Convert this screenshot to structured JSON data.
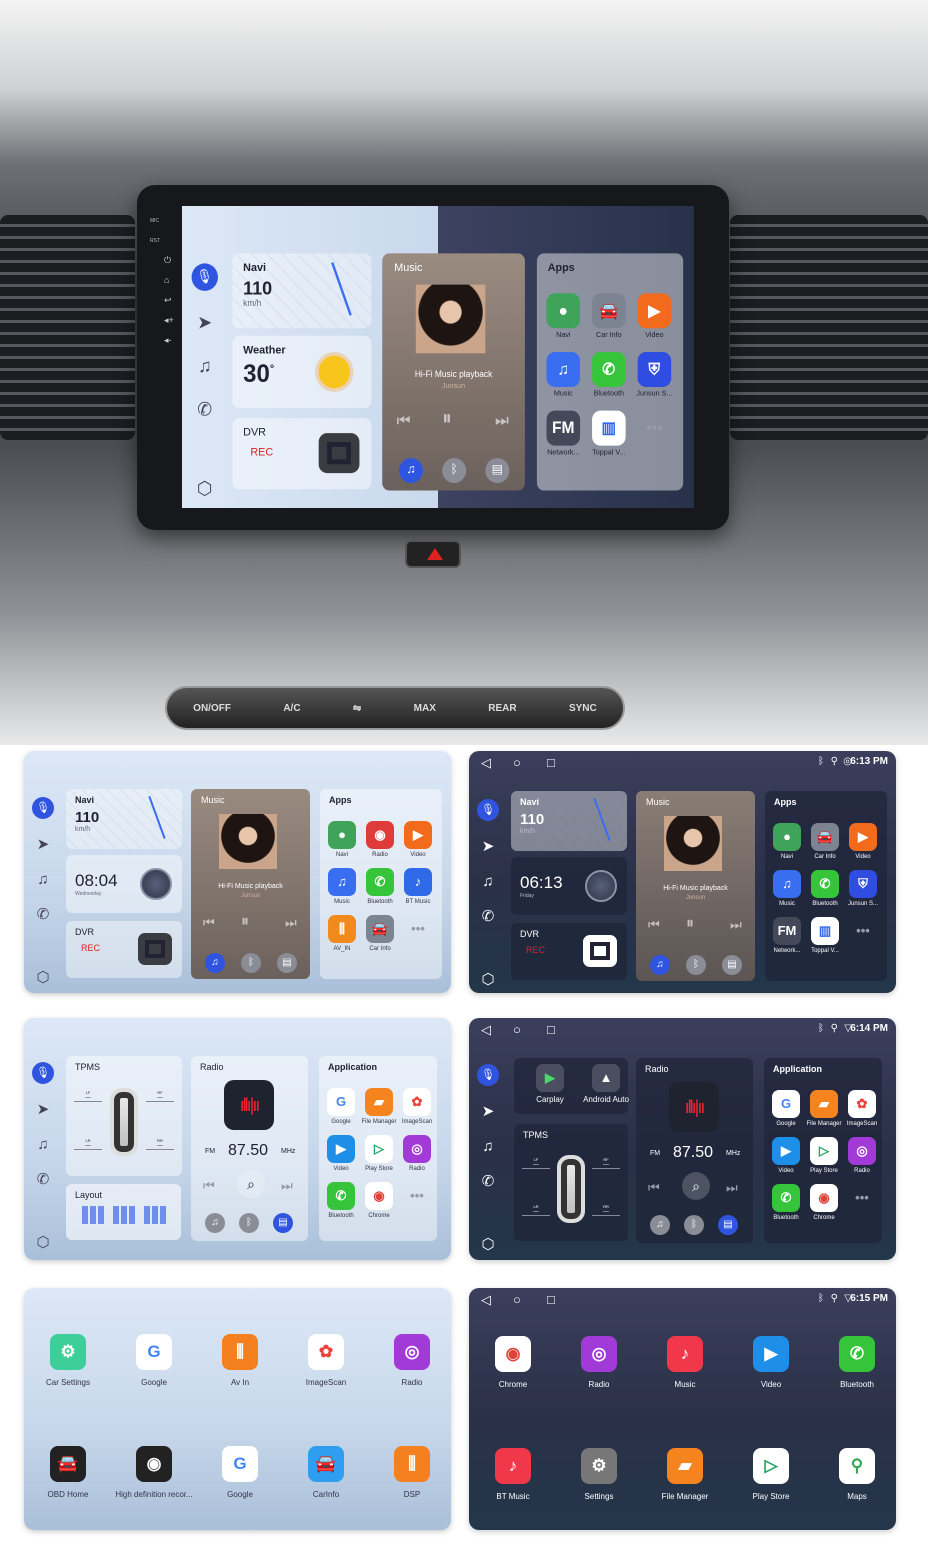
{
  "hero": {
    "side_buttons": [
      "MIC",
      "RST"
    ],
    "climate_buttons": [
      "ON/OFF",
      "A/C",
      "MAX",
      "REAR",
      "SYNC"
    ]
  },
  "screens": [
    {
      "type": "home",
      "theme": "split",
      "status": null,
      "navi": {
        "title": "Navi",
        "speed": "110",
        "unit": "km/h"
      },
      "widget": {
        "kind": "weather",
        "title": "Weather",
        "value": "30",
        "unit": "°"
      },
      "dvr": {
        "title": "DVR",
        "status": "REC"
      },
      "music": {
        "title": "Music",
        "track": "Hi-Fi Music playback",
        "artist": "Junsun"
      },
      "apps": {
        "title": "Apps",
        "items": [
          {
            "label": "Navi",
            "icon": "map-pin",
            "color": "#3fa35a"
          },
          {
            "label": "Car Info",
            "icon": "car",
            "color": "#7d8491"
          },
          {
            "label": "Video",
            "icon": "play",
            "color": "#f26b1d"
          },
          {
            "label": "Music",
            "icon": "music",
            "color": "#3a6ef0"
          },
          {
            "label": "Bluetooth",
            "icon": "phone",
            "color": "#35c43a"
          },
          {
            "label": "Junsun S...",
            "icon": "shield",
            "color": "#2f4de0"
          },
          {
            "label": "Network...",
            "icon": "fm",
            "color": "#44495a"
          },
          {
            "label": "Toppal V...",
            "icon": "wave",
            "color": "#ffffff"
          },
          {
            "label": "",
            "icon": "more",
            "color": "transparent"
          }
        ]
      }
    },
    {
      "type": "home",
      "theme": "light",
      "status": null,
      "navi": {
        "title": "Navi",
        "speed": "110",
        "unit": "km/h"
      },
      "widget": {
        "kind": "clock",
        "value": "08:04",
        "sub": "Wednesday"
      },
      "dvr": {
        "title": "DVR",
        "status": "REC"
      },
      "music": {
        "title": "Music",
        "track": "Hi-Fi Music playback",
        "artist": "Junsun"
      },
      "apps": {
        "title": "Apps",
        "items": [
          {
            "label": "Navi",
            "icon": "map-pin",
            "color": "#3fa35a"
          },
          {
            "label": "Radio",
            "icon": "radio",
            "color": "#e03b3b"
          },
          {
            "label": "Video",
            "icon": "play",
            "color": "#f26b1d"
          },
          {
            "label": "Music",
            "icon": "music",
            "color": "#3a6ef0"
          },
          {
            "label": "Bluetooth",
            "icon": "phone",
            "color": "#35c43a"
          },
          {
            "label": "BT Music",
            "icon": "bt-music",
            "color": "#2f6be8"
          },
          {
            "label": "AV_IN",
            "icon": "sliders",
            "color": "#f08a1d"
          },
          {
            "label": "Car Info",
            "icon": "car",
            "color": "#7d8491"
          },
          {
            "label": "",
            "icon": "more",
            "color": "transparent"
          }
        ]
      }
    },
    {
      "type": "home",
      "theme": "dark",
      "status": {
        "time": "6:13 PM",
        "wifi": "hotspot"
      },
      "navi": {
        "title": "Navi",
        "speed": "110",
        "unit": "km/h"
      },
      "widget": {
        "kind": "clock",
        "value": "06:13",
        "sub": "Friday"
      },
      "dvr": {
        "title": "DVR",
        "status": "REC"
      },
      "music": {
        "title": "Music",
        "track": "Hi-Fi Music playback",
        "artist": "Junsun"
      },
      "apps": {
        "title": "Apps",
        "items": [
          {
            "label": "Navi",
            "icon": "map-pin",
            "color": "#3fa35a"
          },
          {
            "label": "Car Info",
            "icon": "car",
            "color": "#7d8491"
          },
          {
            "label": "Video",
            "icon": "play",
            "color": "#f26b1d"
          },
          {
            "label": "Music",
            "icon": "music",
            "color": "#3a6ef0"
          },
          {
            "label": "Bluetooth",
            "icon": "phone",
            "color": "#35c43a"
          },
          {
            "label": "Junsun S...",
            "icon": "shield",
            "color": "#2f4de0"
          },
          {
            "label": "Network...",
            "icon": "fm",
            "color": "#44495a"
          },
          {
            "label": "Toppal V...",
            "icon": "wave",
            "color": "#ffffff"
          },
          {
            "label": "",
            "icon": "more",
            "color": "transparent"
          }
        ]
      }
    },
    {
      "type": "radio",
      "theme": "light",
      "status": null,
      "tpms": {
        "title": "TPMS",
        "tires": [
          {
            "pos": "LF",
            "value": "---"
          },
          {
            "pos": "RF",
            "value": "---"
          },
          {
            "pos": "LR",
            "value": "---"
          },
          {
            "pos": "RR",
            "value": "---"
          }
        ]
      },
      "layout": {
        "title": "Layout"
      },
      "radio": {
        "title": "Radio",
        "band": "FM",
        "freq": "87.50",
        "unit": "MHz"
      },
      "apps": {
        "title": "Application",
        "items": [
          {
            "label": "Google",
            "icon": "google",
            "color": "#ffffff"
          },
          {
            "label": "File Manager",
            "icon": "folder",
            "color": "#f5841f"
          },
          {
            "label": "ImageScan",
            "icon": "photos",
            "color": "#ffffff"
          },
          {
            "label": "Video",
            "icon": "video",
            "color": "#1e8fe8"
          },
          {
            "label": "Play Store",
            "icon": "play-store",
            "color": "#ffffff"
          },
          {
            "label": "Radio",
            "icon": "podcast",
            "color": "#a23ad8"
          },
          {
            "label": "Bluetooth",
            "icon": "phone",
            "color": "#35c43a"
          },
          {
            "label": "Chrome",
            "icon": "chrome",
            "color": "#ffffff"
          },
          {
            "label": "",
            "icon": "more",
            "color": "transparent"
          }
        ]
      }
    },
    {
      "type": "radio",
      "theme": "dark",
      "status": {
        "time": "6:14 PM",
        "wifi": "wifi"
      },
      "projection": [
        {
          "label": "Carplay",
          "icon": "carplay"
        },
        {
          "label": "Android Auto",
          "icon": "android-auto"
        }
      ],
      "tpms": {
        "title": "TPMS",
        "tires": [
          {
            "pos": "LF",
            "value": "---"
          },
          {
            "pos": "RF",
            "value": "---"
          },
          {
            "pos": "LR",
            "value": "---"
          },
          {
            "pos": "RR",
            "value": "---"
          }
        ]
      },
      "radio": {
        "title": "Radio",
        "band": "FM",
        "freq": "87.50",
        "unit": "MHz"
      },
      "apps": {
        "title": "Application",
        "items": [
          {
            "label": "Google",
            "icon": "google",
            "color": "#ffffff"
          },
          {
            "label": "File Manager",
            "icon": "folder",
            "color": "#f5841f"
          },
          {
            "label": "ImageScan",
            "icon": "photos",
            "color": "#ffffff"
          },
          {
            "label": "Video",
            "icon": "video",
            "color": "#1e8fe8"
          },
          {
            "label": "Play Store",
            "icon": "play-store",
            "color": "#ffffff"
          },
          {
            "label": "Radio",
            "icon": "podcast",
            "color": "#a23ad8"
          },
          {
            "label": "Bluetooth",
            "icon": "phone",
            "color": "#35c43a"
          },
          {
            "label": "Chrome",
            "icon": "chrome",
            "color": "#ffffff"
          },
          {
            "label": "",
            "icon": "more",
            "color": "transparent"
          }
        ]
      }
    },
    {
      "type": "grid",
      "theme": "light",
      "status": null,
      "apps": {
        "items": [
          {
            "label": "Car Settings",
            "icon": "car-settings",
            "color": "#3ccf9a"
          },
          {
            "label": "Google",
            "icon": "google",
            "color": "#ffffff"
          },
          {
            "label": "Av In",
            "icon": "sliders",
            "color": "#f5801f"
          },
          {
            "label": "ImageScan",
            "icon": "photos",
            "color": "#ffffff"
          },
          {
            "label": "Radio",
            "icon": "podcast",
            "color": "#a23ad8"
          },
          {
            "label": "OBD Home",
            "icon": "car",
            "color": "#222222"
          },
          {
            "label": "High definition recor...",
            "icon": "camera",
            "color": "#222222"
          },
          {
            "label": "Google",
            "icon": "google",
            "color": "#ffffff"
          },
          {
            "label": "CarInfo",
            "icon": "car",
            "color": "#2f9ef0"
          },
          {
            "label": "DSP",
            "icon": "sliders",
            "color": "#f5801f"
          }
        ]
      }
    },
    {
      "type": "grid",
      "theme": "dark",
      "status": {
        "time": "6:15 PM",
        "wifi": "wifi"
      },
      "apps": {
        "items": [
          {
            "label": "Chrome",
            "icon": "chrome",
            "color": "#ffffff"
          },
          {
            "label": "Radio",
            "icon": "podcast",
            "color": "#a23ad8"
          },
          {
            "label": "Music",
            "icon": "music-note",
            "color": "#f0384a"
          },
          {
            "label": "Video",
            "icon": "video",
            "color": "#1e8fe8"
          },
          {
            "label": "Bluetooth",
            "icon": "phone",
            "color": "#35c43a"
          },
          {
            "label": "BT Music",
            "icon": "bt-music",
            "color": "#f0384a"
          },
          {
            "label": "Settings",
            "icon": "gear",
            "color": "#777777"
          },
          {
            "label": "File Manager",
            "icon": "folder",
            "color": "#f5841f"
          },
          {
            "label": "Play Store",
            "icon": "play-store",
            "color": "#ffffff"
          },
          {
            "label": "Maps",
            "icon": "maps",
            "color": "#ffffff"
          }
        ]
      }
    }
  ]
}
